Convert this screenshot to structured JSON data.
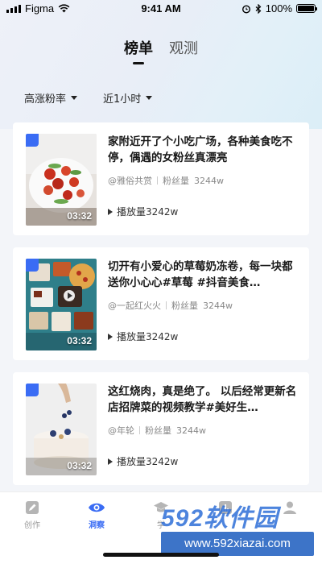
{
  "status_bar": {
    "carrier": "Figma",
    "time": "9:41 AM",
    "battery": "100%"
  },
  "tabs": [
    {
      "label": "榜单",
      "active": true
    },
    {
      "label": "观测",
      "active": false
    }
  ],
  "filters": [
    {
      "label": "高涨粉率"
    },
    {
      "label": "近1小时"
    }
  ],
  "cards": [
    {
      "title": "家附近开了个小吃广场，各种美食吃不停，偶遇的女粉丝真漂亮",
      "author": "@雅俗共赏",
      "fans_label": "粉丝量",
      "fans": "3244w",
      "plays": "播放量3242w",
      "duration": "03:32"
    },
    {
      "title": "切开有小爱心的草莓奶冻卷，每一块都送你小心心#草莓 #抖音美食…",
      "author": "@一起红火火",
      "fans_label": "粉丝量",
      "fans": "3244w",
      "plays": "播放量3242w",
      "duration": "03:32"
    },
    {
      "title": "这红烧肉，真是绝了。 以后经常更新名店招牌菜的视频教学#美好生…",
      "author": "@年轮",
      "fans_label": "粉丝量",
      "fans": "3244w",
      "plays": "播放量3242w",
      "duration": "03:32"
    }
  ],
  "bottom_nav": [
    {
      "label": "创作",
      "icon": "pencil-icon",
      "active": false
    },
    {
      "label": "洞察",
      "icon": "eye-icon",
      "active": true
    },
    {
      "label": "学",
      "icon": "graduation-cap-icon",
      "active": false
    },
    {
      "label": "",
      "icon": "chart-icon",
      "active": false
    },
    {
      "label": "",
      "icon": "user-icon",
      "active": false
    }
  ],
  "watermark": {
    "logo": "592软件园",
    "url": "www.592xiazai.com"
  },
  "colors": {
    "accent": "#3a6cf4",
    "text": "#1a1a1a",
    "muted": "#888888"
  }
}
